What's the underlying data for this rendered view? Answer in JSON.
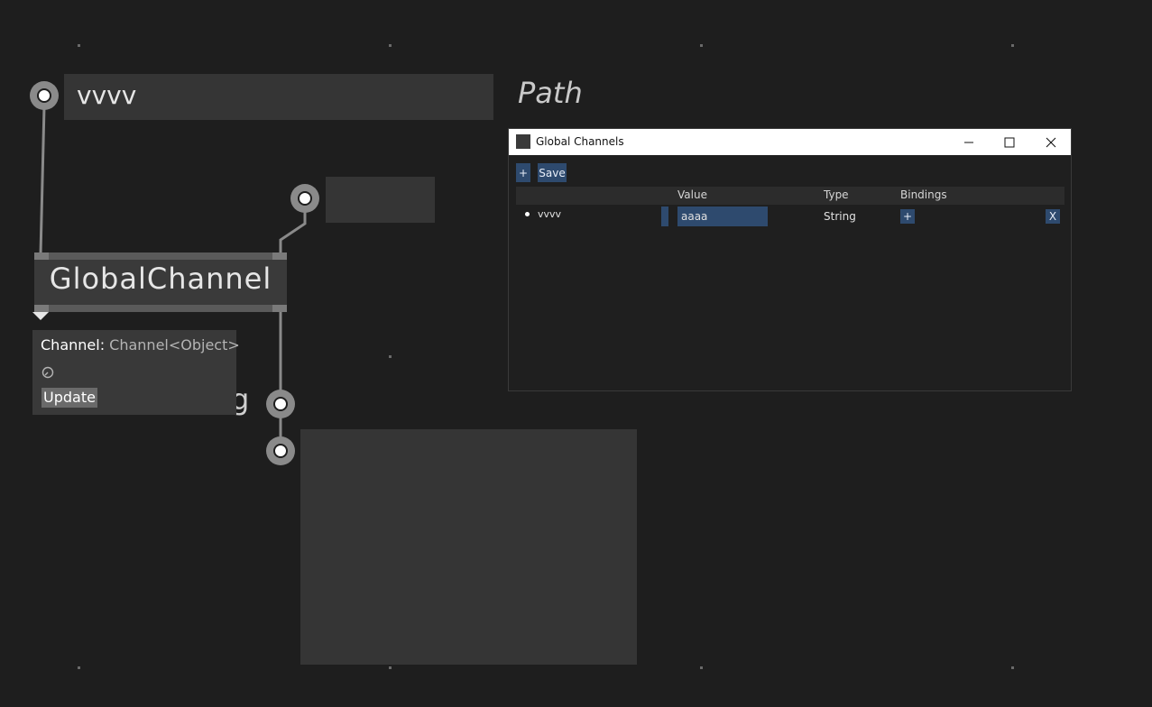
{
  "canvas": {
    "background": "#1e1e1e"
  },
  "patch": {
    "iobox_string_value": "vvvv",
    "path_label": "Path",
    "node_name": "GlobalChannel",
    "partial_label": "g"
  },
  "tooltip": {
    "pin_name": "Channel",
    "separator": ":",
    "pin_type": "Channel<Object>",
    "update_label": "Update"
  },
  "global_channels_window": {
    "title": "Global Channels",
    "toolbar": {
      "add_label": "+",
      "save_label": "Save"
    },
    "columns": {
      "value": "Value",
      "type": "Type",
      "bindings": "Bindings"
    },
    "rows": [
      {
        "name": "vvvv",
        "value": "aaaa",
        "type": "String",
        "add_binding_label": "+",
        "remove_label": "X"
      }
    ],
    "accent_color": "#2e4a6e"
  },
  "icons": {
    "window_app": "app-icon",
    "minimize": "minimize-icon",
    "maximize": "maximize-icon",
    "close": "close-icon",
    "tooltip_clock": "clock-icon"
  }
}
